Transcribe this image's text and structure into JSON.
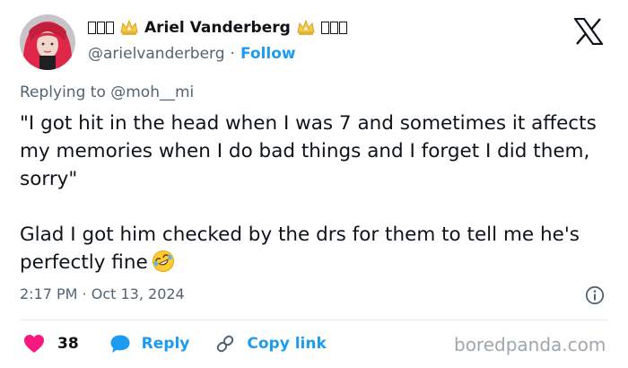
{
  "author": {
    "display_name": "Ariel Vanderberg",
    "handle": "@arielvanderberg",
    "separator": "·",
    "follow_label": "Follow"
  },
  "tweet": {
    "replying_prefix": "Replying to ",
    "replying_handle": "@moh__mi",
    "paragraph_1": "\"I got hit in the head when I was 7 and sometimes it affects my memories when I do bad things and I forget I did them, sorry\"",
    "paragraph_2": "Glad I got him checked by the drs for them to tell me he's perfectly fine",
    "timestamp": "2:17 PM · Oct 13, 2024"
  },
  "actions": {
    "like_count": "38",
    "reply_label": "Reply",
    "copy_link_label": "Copy link"
  },
  "watermark": "boredpanda.com",
  "colors": {
    "accent": "#1d9bf0",
    "like": "#f91880",
    "text": "#0f1419",
    "muted": "#536471",
    "crown": "#f2c94c"
  },
  "icons": [
    "avatar",
    "crown-icon",
    "x-logo-icon",
    "rolling-laughing-emoji",
    "info-icon",
    "heart-icon",
    "reply-icon",
    "link-icon"
  ]
}
